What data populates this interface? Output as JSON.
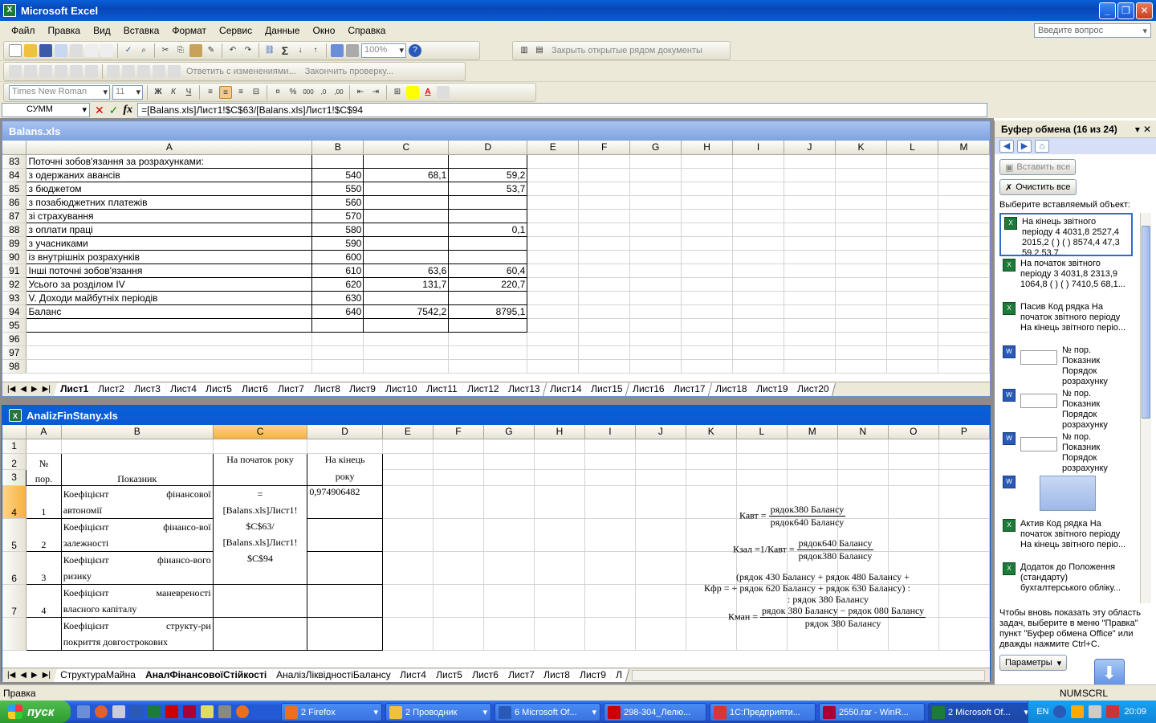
{
  "app": {
    "title": "Microsoft Excel"
  },
  "menu": [
    "Файл",
    "Правка",
    "Вид",
    "Вставка",
    "Формат",
    "Сервис",
    "Данные",
    "Окно",
    "Справка"
  ],
  "help_placeholder": "Введите вопрос",
  "toolbar": {
    "zoom": "100%",
    "close_side_by_side": "Закрыть открытые рядом документы",
    "reply_changes": "Ответить с изменениями...",
    "end_review": "Закончить проверку...",
    "font_name": "Times New Roman",
    "font_size": "11"
  },
  "formula_bar": {
    "name_box": "СУММ",
    "formula": "=[Balans.xls]Лист1!$C$63/[Balans.xls]Лист1!$C$94"
  },
  "balans": {
    "title": "Balans.xls",
    "columns": [
      "A",
      "B",
      "C",
      "D",
      "E",
      "F",
      "G",
      "H",
      "I",
      "J",
      "K",
      "L",
      "M"
    ],
    "rows": [
      {
        "n": "83",
        "a": "Поточні зобов'язання за розрахунками:",
        "b": "",
        "c": "",
        "d": ""
      },
      {
        "n": "84",
        "a": "з одержаних авансів",
        "b": "540",
        "c": "68,1",
        "d": "59,2"
      },
      {
        "n": "85",
        "a": "з бюджетом",
        "b": "550",
        "c": "",
        "d": "53,7"
      },
      {
        "n": "86",
        "a": "з позабюджетних платежів",
        "b": "560",
        "c": "",
        "d": ""
      },
      {
        "n": "87",
        "a": "зі страхування",
        "b": "570",
        "c": "",
        "d": ""
      },
      {
        "n": "88",
        "a": "з оплати праці",
        "b": "580",
        "c": "",
        "d": "0,1"
      },
      {
        "n": "89",
        "a": "з учасниками",
        "b": "590",
        "c": "",
        "d": ""
      },
      {
        "n": "90",
        "a": "із внутрішніх розрахунків",
        "b": "600",
        "c": "",
        "d": ""
      },
      {
        "n": "91",
        "a": "Інші поточні зобов'язання",
        "b": "610",
        "c": "63,6",
        "d": "60,4"
      },
      {
        "n": "92",
        "a": "Усього за розділом IV",
        "b": "620",
        "c": "131,7",
        "d": "220,7"
      },
      {
        "n": "93",
        "a": "V. Доходи майбутніх періодів",
        "b": "630",
        "c": "",
        "d": ""
      },
      {
        "n": "94",
        "a": "Баланс",
        "b": "640",
        "c": "7542,2",
        "d": "8795,1"
      },
      {
        "n": "95",
        "a": "",
        "b": "",
        "c": "",
        "d": ""
      },
      {
        "n": "96",
        "a": "",
        "b": "",
        "c": "",
        "d": ""
      },
      {
        "n": "97",
        "a": "",
        "b": "",
        "c": "",
        "d": ""
      },
      {
        "n": "98",
        "a": "",
        "b": "",
        "c": "",
        "d": ""
      }
    ],
    "tabs": [
      "Лист1",
      "Лист2",
      "Лист3",
      "Лист4",
      "Лист5",
      "Лист6",
      "Лист7",
      "Лист8",
      "Лист9",
      "Лист10",
      "Лист11",
      "Лист12",
      "Лист13",
      "Лист14",
      "Лист15",
      "Лист16",
      "Лист17",
      "Лист18",
      "Лист19",
      "Лист20"
    ]
  },
  "analiz": {
    "title": "AnalizFinStany.xls",
    "columns": [
      "A",
      "B",
      "C",
      "D",
      "E",
      "F",
      "G",
      "H",
      "I",
      "J",
      "K",
      "L",
      "M",
      "N",
      "O",
      "P"
    ],
    "header": {
      "num1": "№",
      "num2": "пор.",
      "indicator": "Показник",
      "start": "На початок року",
      "end1": "На кінець",
      "end2": "року"
    },
    "rows": [
      {
        "n": "1",
        "l1": "Коефіцієнт",
        "l2": "фінансової",
        "l3": "автономії"
      },
      {
        "n": "2",
        "l1": "Коефіцієнт",
        "l2": "фінансо-вої",
        "l3": "залежності"
      },
      {
        "n": "3",
        "l1": "Коефіцієнт",
        "l2": "фінансо-вого",
        "l3": "ризику"
      },
      {
        "n": "4",
        "l1": "Коефіцієнт",
        "l2": "маневреності",
        "l3": "власного капіталу"
      },
      {
        "n": "",
        "l1": "Коефіцієнт",
        "l2": "структу-ри",
        "l3": "покриття     довгострокових"
      }
    ],
    "cell_c4": [
      "=",
      "[Balans.xls]Лист1!",
      "$C$63/",
      "[Balans.xls]Лист1!",
      "$C$94"
    ],
    "cell_d4": "0,974906482",
    "formulas": {
      "f1": {
        "lhs": "Кавт =",
        "num": "рядок380 Балансу",
        "den": "рядок640 Балансу"
      },
      "f2": {
        "lhs": "Кзал =1/Кавт =",
        "num": "рядок640 Балансу",
        "den": "рядок380 Балансу"
      },
      "f3": {
        "line1": "(рядок  430  Балансу  + рядок  480  Балансу +",
        "lhs": "Кфр  =",
        "line2": "+ рядок  620  Балансу + рядок 630  Балансу) :",
        "line3": ": рядок  380  Балансу"
      },
      "f4": {
        "lhs": "Кман =",
        "num": "рядок 380  Балансу  − рядок  080  Балансу",
        "den": "рядок  380  Балансу"
      }
    },
    "tabs": [
      "СтруктураМайна",
      "АналФінансовоїСтійкості",
      "АналізЛіквідностіБалансу",
      "Лист4",
      "Лист5",
      "Лист6",
      "Лист7",
      "Лист8",
      "Лист9",
      "Л"
    ]
  },
  "clipboard": {
    "title": "Буфер обмена (16 из 24)",
    "paste_all": "Вставить все",
    "clear_all": "Очистить все",
    "prompt": "Выберите вставляемый объект:",
    "items": [
      "На кінець звітного періоду 4 4031,8 2527,4 2015,2 ( ) ( ) 8574,4 47,3 59,2 53,7...",
      "На початок звітного періоду 3 4031,8 2313,9 1064,8 ( ) ( ) 7410,5 68,1...",
      "Пасив Код рядка На початок звітного періоду На кінець звітного періо...",
      "№ пор. Показник Порядок розрахунку пока...",
      "№ пор. Показник Порядок розрахунку пока...",
      "№ пор. Показник Порядок розрахунку пока...",
      "",
      "Актив Код рядка На початок звітного періоду На кінець звітного періо...",
      "Додаток до Положення (стандарту) бухгалтерського обліку..."
    ],
    "footer": "Чтобы вновь показать эту область задач, выберите в меню \"Правка\" пункт \"Буфер обмена Office\" или дважды нажмите Ctrl+C.",
    "options": "Параметры"
  },
  "status": {
    "left": "Правка",
    "num": "NUM",
    "scrl": "SCRL"
  },
  "taskbar": {
    "start": "пуск",
    "tasks": [
      "2 Firefox",
      "2 Проводник",
      "6 Microsoft Of...",
      "298-304_Лелю...",
      "1С:Предприяти...",
      "2550.rar - WinR...",
      "2 Microsoft Of..."
    ],
    "lang": "EN",
    "time": "20:09"
  }
}
